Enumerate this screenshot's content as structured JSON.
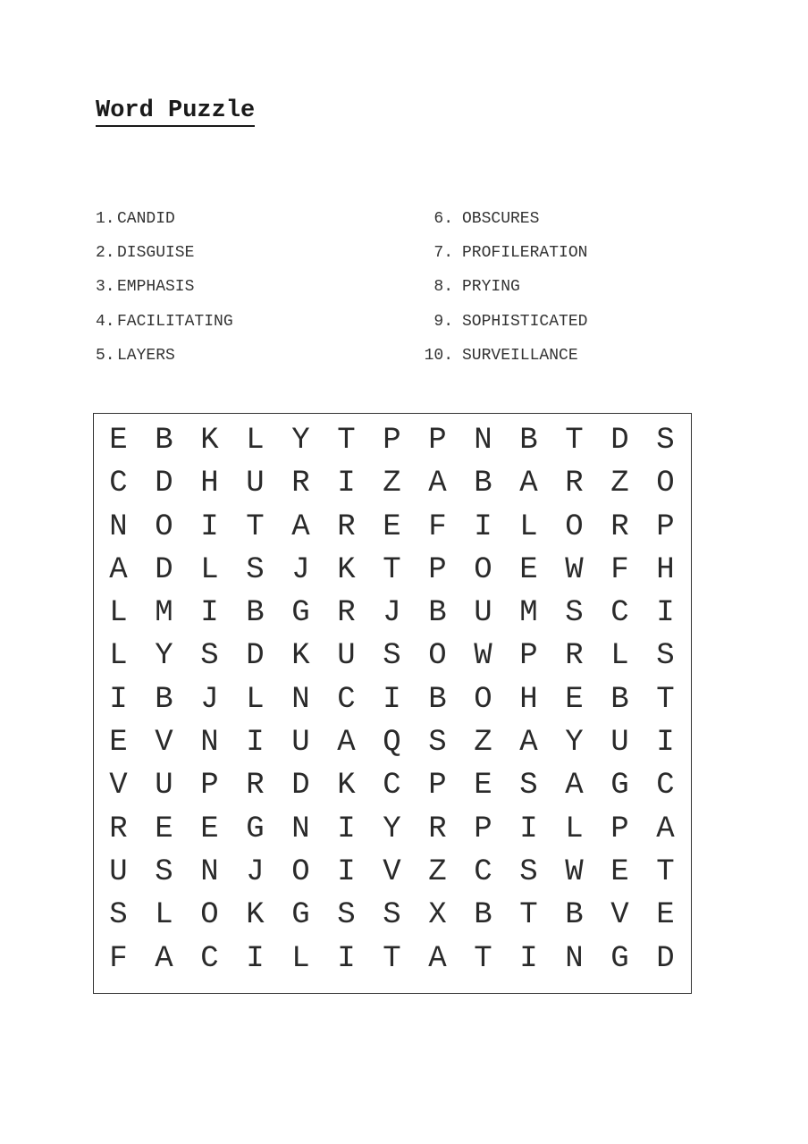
{
  "title": "Word Puzzle",
  "words_left": [
    {
      "num": "1.",
      "word": "CANDID"
    },
    {
      "num": "2.",
      "word": "DISGUISE"
    },
    {
      "num": "3.",
      "word": "EMPHASIS"
    },
    {
      "num": "4.",
      "word": "FACILITATING"
    },
    {
      "num": "5.",
      "word": "LAYERS"
    }
  ],
  "words_right": [
    {
      "num": "6.",
      "word": "OBSCURES"
    },
    {
      "num": "7.",
      "word": "PROFILERATION"
    },
    {
      "num": "8.",
      "word": "PRYING"
    },
    {
      "num": "9.",
      "word": "SOPHISTICATED"
    },
    {
      "num": "10.",
      "word": "SURVEILLANCE"
    }
  ],
  "grid": [
    [
      "E",
      "B",
      "K",
      "L",
      "Y",
      "T",
      "P",
      "P",
      "N",
      "B",
      "T",
      "D",
      "S"
    ],
    [
      "C",
      "D",
      "H",
      "U",
      "R",
      "I",
      "Z",
      "A",
      "B",
      "A",
      "R",
      "Z",
      "O"
    ],
    [
      "N",
      "O",
      "I",
      "T",
      "A",
      "R",
      "E",
      "F",
      "I",
      "L",
      "O",
      "R",
      "P"
    ],
    [
      "A",
      "D",
      "L",
      "S",
      "J",
      "K",
      "T",
      "P",
      "O",
      "E",
      "W",
      "F",
      "H"
    ],
    [
      "L",
      "M",
      "I",
      "B",
      "G",
      "R",
      "J",
      "B",
      "U",
      "M",
      "S",
      "C",
      "I"
    ],
    [
      "L",
      "Y",
      "S",
      "D",
      "K",
      "U",
      "S",
      "O",
      "W",
      "P",
      "R",
      "L",
      "S"
    ],
    [
      "I",
      "B",
      "J",
      "L",
      "N",
      "C",
      "I",
      "B",
      "O",
      "H",
      "E",
      "B",
      "T"
    ],
    [
      "E",
      "V",
      "N",
      "I",
      "U",
      "A",
      "Q",
      "S",
      "Z",
      "A",
      "Y",
      "U",
      "I"
    ],
    [
      "V",
      "U",
      "P",
      "R",
      "D",
      "K",
      "C",
      "P",
      "E",
      "S",
      "A",
      "G",
      "C"
    ],
    [
      "R",
      "E",
      "E",
      "G",
      "N",
      "I",
      "Y",
      "R",
      "P",
      "I",
      "L",
      "P",
      "A"
    ],
    [
      "U",
      "S",
      "N",
      "J",
      "O",
      "I",
      "V",
      "Z",
      "C",
      "S",
      "W",
      "E",
      "T"
    ],
    [
      "S",
      "L",
      "O",
      "K",
      "G",
      "S",
      "S",
      "X",
      "B",
      "T",
      "B",
      "V",
      "E"
    ],
    [
      "F",
      "A",
      "C",
      "I",
      "L",
      "I",
      "T",
      "A",
      "T",
      "I",
      "N",
      "G",
      "D"
    ]
  ]
}
